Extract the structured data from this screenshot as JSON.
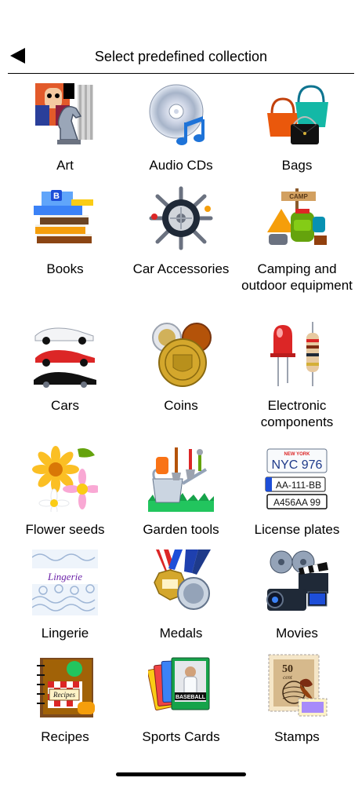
{
  "header": {
    "title": "Select predefined collection",
    "back_icon": "back-triangle-icon"
  },
  "collections": [
    {
      "label": "Art",
      "icon": "art-icon"
    },
    {
      "label": "Audio CDs",
      "icon": "audio-cd-icon"
    },
    {
      "label": "Bags",
      "icon": "bags-icon"
    },
    {
      "label": "Books",
      "icon": "books-icon"
    },
    {
      "label": "Car Accessories",
      "icon": "car-accessories-icon"
    },
    {
      "label": "Camping and outdoor equipment",
      "icon": "camping-icon"
    },
    {
      "label": "Cars",
      "icon": "cars-icon"
    },
    {
      "label": "Coins",
      "icon": "coins-icon"
    },
    {
      "label": "Electronic components",
      "icon": "electronic-components-icon"
    },
    {
      "label": "Flower seeds",
      "icon": "flower-seeds-icon"
    },
    {
      "label": "Garden tools",
      "icon": "garden-tools-icon"
    },
    {
      "label": "License plates",
      "icon": "license-plates-icon"
    },
    {
      "label": "Lingerie",
      "icon": "lingerie-icon"
    },
    {
      "label": "Medals",
      "icon": "medals-icon"
    },
    {
      "label": "Movies",
      "icon": "movies-icon"
    },
    {
      "label": "Recipes",
      "icon": "recipes-icon"
    },
    {
      "label": "Sports Cards",
      "icon": "sports-cards-icon"
    },
    {
      "label": "Stamps",
      "icon": "stamps-icon"
    }
  ],
  "thumb_text": {
    "books_letter": "B",
    "camp_sign": "CAMP",
    "plate1": "NYC 976",
    "plate1_state": "NEW YORK",
    "plate2": "AA-111-BB",
    "plate3": "A456AA 99",
    "lingerie_word": "Lingerie",
    "recipes_word": "Recipes",
    "sports_word": "BASEBALL",
    "stamp_value": "50",
    "stamp_unit": "cent"
  }
}
